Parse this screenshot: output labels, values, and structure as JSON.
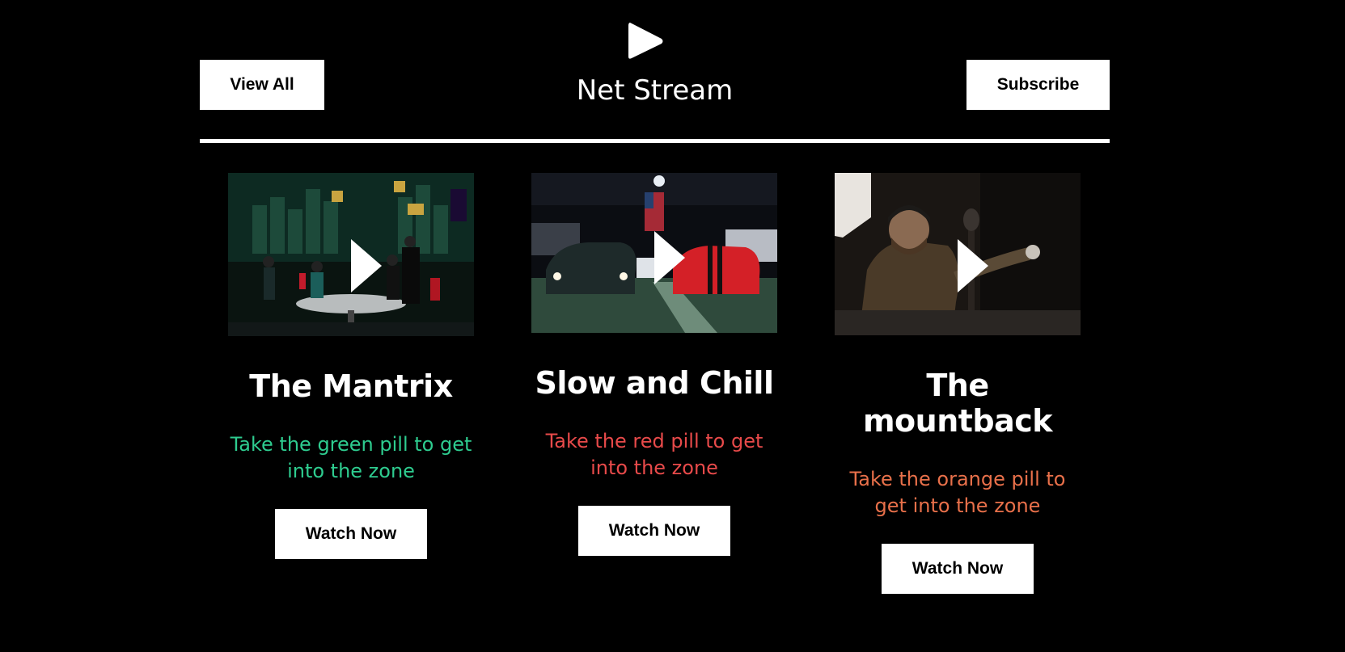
{
  "header": {
    "view_all_label": "View All",
    "title": "Net Stream",
    "subscribe_label": "Subscribe"
  },
  "movies": [
    {
      "title": "The Mantrix",
      "description": "Take the green pill to get into the zone",
      "description_color": "#2ecc8f",
      "button_label": "Watch Now"
    },
    {
      "title": "Slow and Chill",
      "description": "Take the red pill to get into the zone",
      "description_color": "#e84a4a",
      "button_label": "Watch Now"
    },
    {
      "title": "The mountback",
      "description": "Take the orange pill to get into the zone",
      "description_color": "#e8704a",
      "button_label": "Watch Now"
    }
  ]
}
